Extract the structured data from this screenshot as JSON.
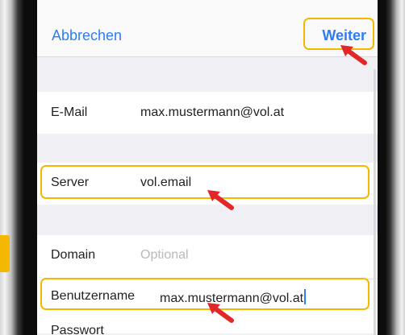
{
  "nav": {
    "cancel_label": "Abbrechen",
    "next_label": "Weiter"
  },
  "fields": {
    "email": {
      "label": "E-Mail",
      "value": "max.mustermann@vol.at"
    },
    "server": {
      "label": "Server",
      "value": "vol.email"
    },
    "domain": {
      "label": "Domain",
      "placeholder": "Optional"
    },
    "username": {
      "label": "Benutzername",
      "value": "max.mustermann@vol.at"
    },
    "password": {
      "label": "Passwort"
    }
  },
  "colors": {
    "accent": "#2f7cf6",
    "highlight": "#f5b800",
    "arrow": "#e2272a"
  }
}
